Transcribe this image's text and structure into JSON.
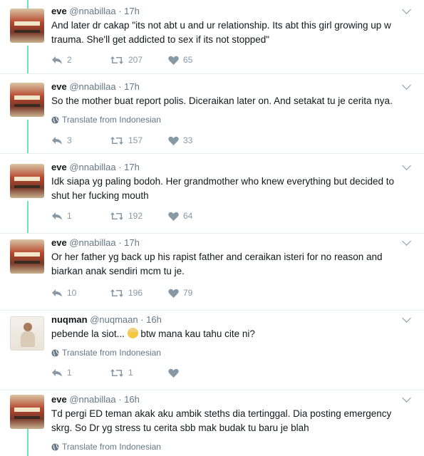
{
  "tweets": [
    {
      "name": "eve",
      "handle": "@nnabillaa",
      "time": "· 17h",
      "text": "And later dr cakap \"its not abt u and ur relationship. Its abt this girl growing up w trauma. She'll get addicted to sex if its not stopped\"",
      "translate": "",
      "replies": "2",
      "retweets": "207",
      "likes": "65",
      "avatar": "building"
    },
    {
      "name": "eve",
      "handle": "@nnabillaa",
      "time": "· 17h",
      "text": "So the mother buat report polis. Diceraikan later on. And setakat tu je cerita nya.",
      "translate": "Translate from Indonesian",
      "replies": "3",
      "retweets": "157",
      "likes": "33",
      "avatar": "building"
    },
    {
      "name": "eve",
      "handle": "@nnabillaa",
      "time": "· 17h",
      "text": "Idk siapa yg paling bodoh. Her grandmother who knew everything but decided to shut her fucking mouth",
      "translate": "",
      "replies": "1",
      "retweets": "192",
      "likes": "64",
      "avatar": "building"
    },
    {
      "name": "eve",
      "handle": "@nnabillaa",
      "time": "· 17h",
      "text": "Or her father yg back up his rapist father and ceraikan isteri for no reason and biarkan anak sendiri mcm tu je.",
      "translate": "",
      "replies": "10",
      "retweets": "196",
      "likes": "79",
      "avatar": "building"
    },
    {
      "name": "nuqman",
      "handle": "@nuqmaan",
      "time": "· 16h",
      "text_before_emoji": "pebende la siot... ",
      "text_after_emoji": " btw mana kau tahu cite ni?",
      "emoji_icon": "person-blond-hair-emoji",
      "translate": "Translate from Indonesian",
      "replies": "1",
      "retweets": "1",
      "likes": "",
      "avatar": "person"
    },
    {
      "name": "eve",
      "handle": "@nnabillaa",
      "time": "· 16h",
      "text": "Td pergi ED teman akak aku ambik steths dia tertinggal. Dia posting emergency skrg. So Dr yg stress tu cerita sbb mak budak tu baru je blah",
      "translate": "Translate from Indonesian",
      "replies": "",
      "retweets": "",
      "likes": "",
      "avatar": "building"
    }
  ],
  "colors": {
    "thread_line": "#6ce3b7",
    "meta_gray": "#657786",
    "icon_gray": "#8899a6",
    "text": "#14171a"
  },
  "icons": {
    "reply": "reply-icon",
    "retweet": "retweet-icon",
    "like": "heart-icon",
    "translate": "globe-icon",
    "menu": "chevron-down-icon"
  }
}
